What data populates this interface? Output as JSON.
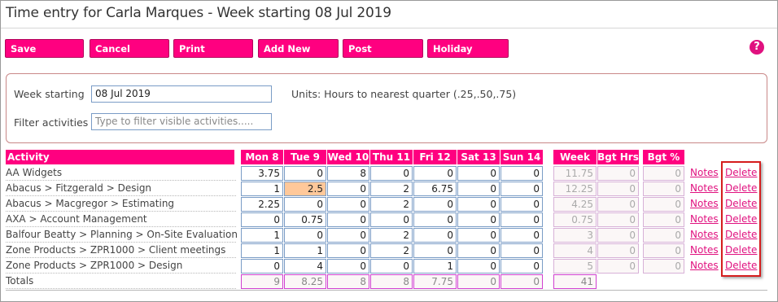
{
  "title": "Time entry for Carla Marques - Week starting 08 Jul 2019",
  "toolbar": {
    "save": "Save",
    "cancel": "Cancel",
    "print": "Print",
    "add_new": "Add New",
    "post": "Post",
    "holiday": "Holiday",
    "help_glyph": "?"
  },
  "filters": {
    "week_label": "Week starting",
    "week_value": "08 Jul 2019",
    "units_text": "Units: Hours to nearest quarter (.25,.50,.75)",
    "filter_label": "Filter activities",
    "filter_placeholder": "Type to filter visible activities....."
  },
  "grid": {
    "headers": [
      "Activity",
      "Mon 8",
      "Tue 9",
      "Wed 10",
      "Thu 11",
      "Fri 12",
      "Sat 13",
      "Sun 14",
      "Week",
      "Bgt Hrs",
      "Bgt %"
    ],
    "notes_label": "Notes",
    "delete_label": "Delete",
    "rows": [
      {
        "activity": "AA Widgets",
        "values": [
          "3.75",
          "0",
          "8",
          "0",
          "0",
          "0",
          "0"
        ],
        "week": "11.75",
        "bgt_hrs": "0",
        "bgt_pct": "0"
      },
      {
        "activity": "Abacus > Fitzgerald > Design",
        "values": [
          "1",
          "2.5",
          "0",
          "2",
          "6.75",
          "0",
          "0"
        ],
        "week": "12.25",
        "bgt_hrs": "0",
        "bgt_pct": "0"
      },
      {
        "activity": "Abacus > Macgregor > Estimating",
        "values": [
          "2.25",
          "0",
          "0",
          "2",
          "0",
          "0",
          "0"
        ],
        "week": "4.25",
        "bgt_hrs": "0",
        "bgt_pct": "0"
      },
      {
        "activity": "AXA > Account Management",
        "values": [
          "0",
          "0.75",
          "0",
          "0",
          "0",
          "0",
          "0"
        ],
        "week": "0.75",
        "bgt_hrs": "0",
        "bgt_pct": "0"
      },
      {
        "activity": "Balfour Beatty > Planning > On-Site Evaluation",
        "values": [
          "1",
          "0",
          "0",
          "2",
          "0",
          "0",
          "0"
        ],
        "week": "3",
        "bgt_hrs": "0",
        "bgt_pct": "0"
      },
      {
        "activity": "Zone Products > ZPR1000 > Client meetings",
        "values": [
          "1",
          "1",
          "0",
          "2",
          "0",
          "0",
          "0"
        ],
        "week": "4",
        "bgt_hrs": "0",
        "bgt_pct": "0"
      },
      {
        "activity": "Zone Products > ZPR1000 > Design",
        "values": [
          "0",
          "4",
          "0",
          "0",
          "1",
          "0",
          "0"
        ],
        "week": "5",
        "bgt_hrs": "0",
        "bgt_pct": "0"
      }
    ],
    "totals": {
      "label": "Totals",
      "values": [
        "9",
        "8.25",
        "8",
        "8",
        "7.75",
        "0",
        "0"
      ],
      "week": "41"
    }
  },
  "colors": {
    "accent": "#ff0080",
    "link": "#e0117f",
    "highlight_cell": "#ffc89a",
    "callout_border": "#d51d1d"
  },
  "icons": {
    "help": "help-icon"
  }
}
